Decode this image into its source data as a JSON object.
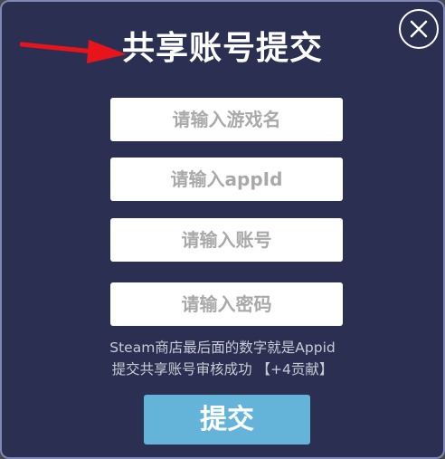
{
  "dialog": {
    "title": "共享账号提交",
    "close_icon": "close-icon",
    "inputs": [
      {
        "placeholder": "请输入游戏名",
        "value": ""
      },
      {
        "placeholder": "请输入appId",
        "value": ""
      },
      {
        "placeholder": "请输入账号",
        "value": ""
      },
      {
        "placeholder": "请输入密码",
        "value": ""
      }
    ],
    "hint_line1": "Steam商店最后面的数字就是Appid",
    "hint_line2": "提交共享账号审核成功 【+4贡献】",
    "submit_label": "提交"
  },
  "colors": {
    "dialog_bg": "#2b3052",
    "dialog_border": "#7f89b5",
    "submit_bg": "#64b4da",
    "annotation_arrow": "#e8141c"
  }
}
